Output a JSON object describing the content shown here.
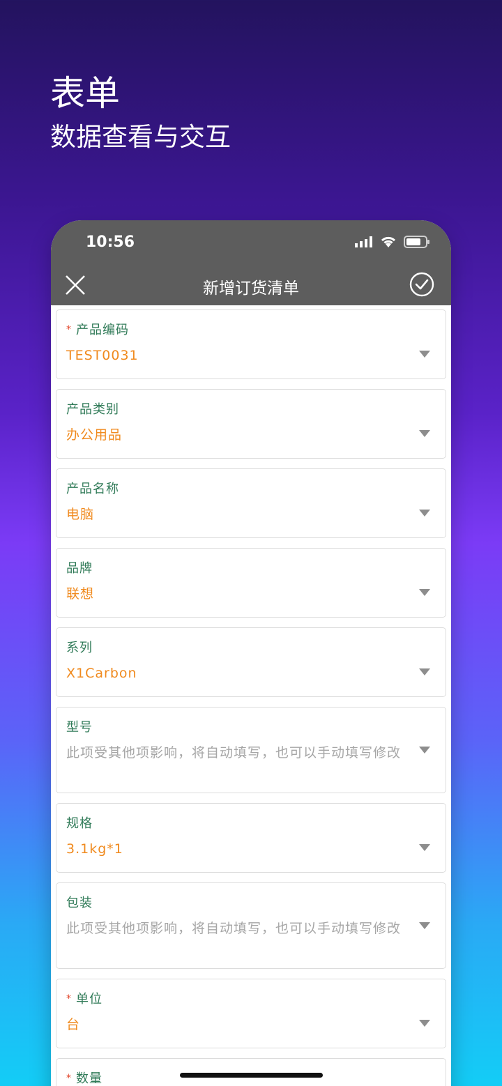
{
  "promo": {
    "title": "表单",
    "subtitle": "数据查看与交互"
  },
  "status": {
    "time": "10:56"
  },
  "nav": {
    "title": "新增订货清单",
    "close_icon": "close-icon",
    "confirm_icon": "check-circle-icon"
  },
  "form": {
    "fields": [
      {
        "label": "产品编码",
        "required": true,
        "value": "TEST0031",
        "placeholder": false
      },
      {
        "label": "产品类别",
        "required": false,
        "value": "办公用品",
        "placeholder": false
      },
      {
        "label": "产品名称",
        "required": false,
        "value": "电脑",
        "placeholder": false
      },
      {
        "label": "品牌",
        "required": false,
        "value": "联想",
        "placeholder": false
      },
      {
        "label": "系列",
        "required": false,
        "value": "X1Carbon",
        "placeholder": false
      },
      {
        "label": "型号",
        "required": false,
        "value": "此项受其他项影响，将自动填写，也可以手动填写修改",
        "placeholder": true
      },
      {
        "label": "规格",
        "required": false,
        "value": "3.1kg*1",
        "placeholder": false
      },
      {
        "label": "包装",
        "required": false,
        "value": "此项受其他项影响，将自动填写，也可以手动填写修改",
        "placeholder": true
      },
      {
        "label": "单位",
        "required": true,
        "value": "台",
        "placeholder": false
      },
      {
        "label": "数量",
        "required": true,
        "value": "",
        "placeholder": false
      }
    ],
    "required_mark": "*"
  },
  "colors": {
    "label": "#2f7a57",
    "value": "#f08a1e",
    "placeholder": "#a6a6a6",
    "required": "#e2462b",
    "bar": "#5d5d5d"
  }
}
